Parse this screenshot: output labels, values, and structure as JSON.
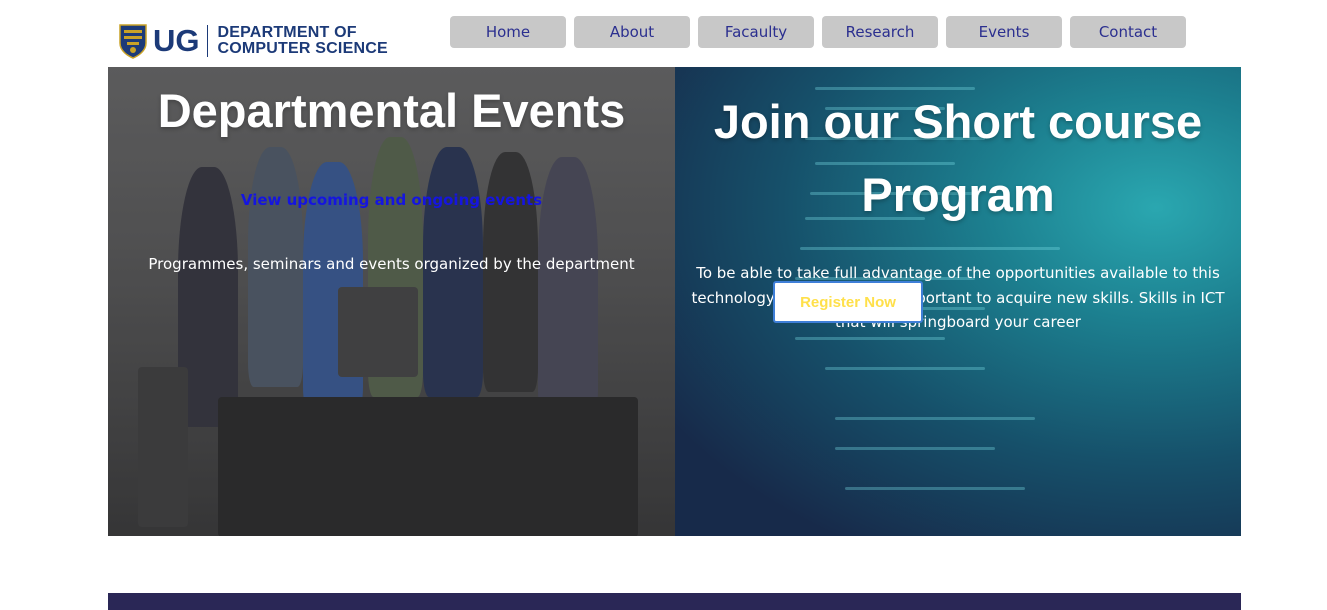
{
  "header": {
    "logo_ug": "UG",
    "logo_dept_line1": "DEPARTMENT OF",
    "logo_dept_line2": "COMPUTER SCIENCE",
    "nav": [
      "Home",
      "About",
      "Facaulty",
      "Research",
      "Events",
      "Contact"
    ]
  },
  "hero_left": {
    "title": "Departmental Events",
    "link": "View upcoming and ongoing events",
    "description": "Programmes, seminars and events organized by the department"
  },
  "hero_right": {
    "title": "Join our Short course Program",
    "description": "To be able to take full advantage of the opportunities available to this technology driven era, it is important to acquire new skills. Skills in ICT that will springboard your career",
    "button": "Register Now"
  },
  "colors": {
    "brand_navy": "#1c3a78",
    "nav_bg": "#c8c8c8",
    "nav_text": "#2b2f8f",
    "link_blue": "#1515e0",
    "button_text": "#ffe04a",
    "footer": "#2a2756"
  },
  "icons": {
    "crest": "university-crest-icon"
  }
}
